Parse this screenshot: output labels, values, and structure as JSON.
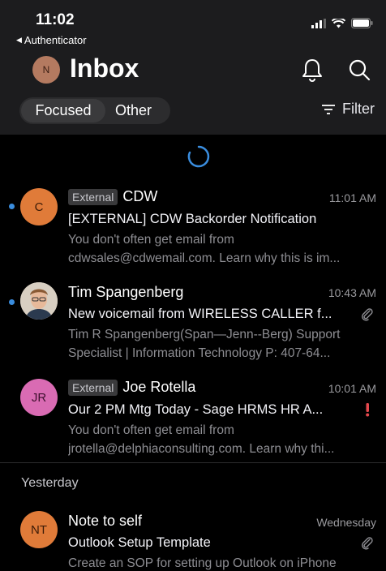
{
  "status": {
    "time": "11:02",
    "back_app": "Authenticator"
  },
  "header": {
    "avatar_initial": "N",
    "title": "Inbox"
  },
  "tabs": {
    "focused": "Focused",
    "other": "Other",
    "selected": "Focused"
  },
  "filter_label": "Filter",
  "colors": {
    "unread_dot": "#3a8dde",
    "flag": "#e5484d",
    "avatar_orange": "#e07b39",
    "avatar_pink": "#d96bb3"
  },
  "messages": [
    {
      "external_tag": "External",
      "sender": "CDW",
      "time": "11:01 AM",
      "avatar": "C",
      "subject": "[EXTERNAL] CDW Backorder Notification",
      "preview_1": "You don't often get email from",
      "preview_2": "cdwsales@cdwemail.com. Learn why this is im...",
      "unread": true
    },
    {
      "sender": "Tim Spangenberg",
      "time": "10:43 AM",
      "avatar": "photo",
      "subject": "New voicemail from WIRELESS CALLER f...",
      "preview_1": "Tim R Spangenberg(Span—Jenn--Berg) Support",
      "preview_2": "Specialist | Information Technology P: 407-64...",
      "unread": true,
      "attachment": true
    },
    {
      "external_tag": "External",
      "sender": "Joe Rotella",
      "time": "10:01 AM",
      "avatar": "JR",
      "subject": "Our 2 PM Mtg Today - Sage HRMS HR A...",
      "preview_1": "You don't often get email from",
      "preview_2": "jrotella@delphiaconsulting.com. Learn why thi...",
      "important": true
    }
  ],
  "section_yesterday": "Yesterday",
  "yesterday_messages": [
    {
      "sender": "Note to self",
      "time": "Wednesday",
      "avatar": "NT",
      "subject": "Outlook Setup Template",
      "preview_1": "Create an SOP for setting up Outlook on iPhone",
      "attachment": true
    }
  ]
}
